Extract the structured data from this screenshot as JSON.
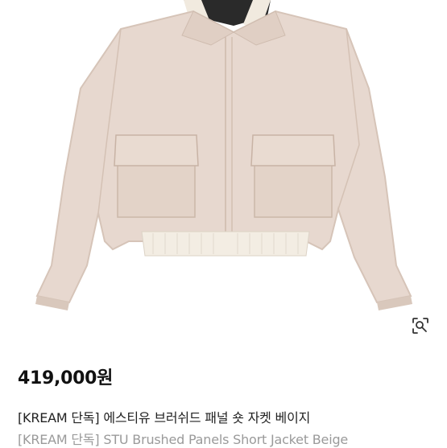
{
  "product": {
    "image_icon": "beige-short-jacket-image",
    "lens_icon": "visual-search-icon",
    "price": "419,000원",
    "title_ko": "[KREAM 단독] 에스티유 브러쉬드 패널 숏 자켓 베이지",
    "title_en": "[KREAM 단독] STU Brushed Panels Short Jacket Beige"
  },
  "colors": {
    "jacket": "#e7d8cf",
    "rib": "#f3ede3",
    "price_text": "#111111",
    "secondary_text": "#9a9a9a"
  }
}
